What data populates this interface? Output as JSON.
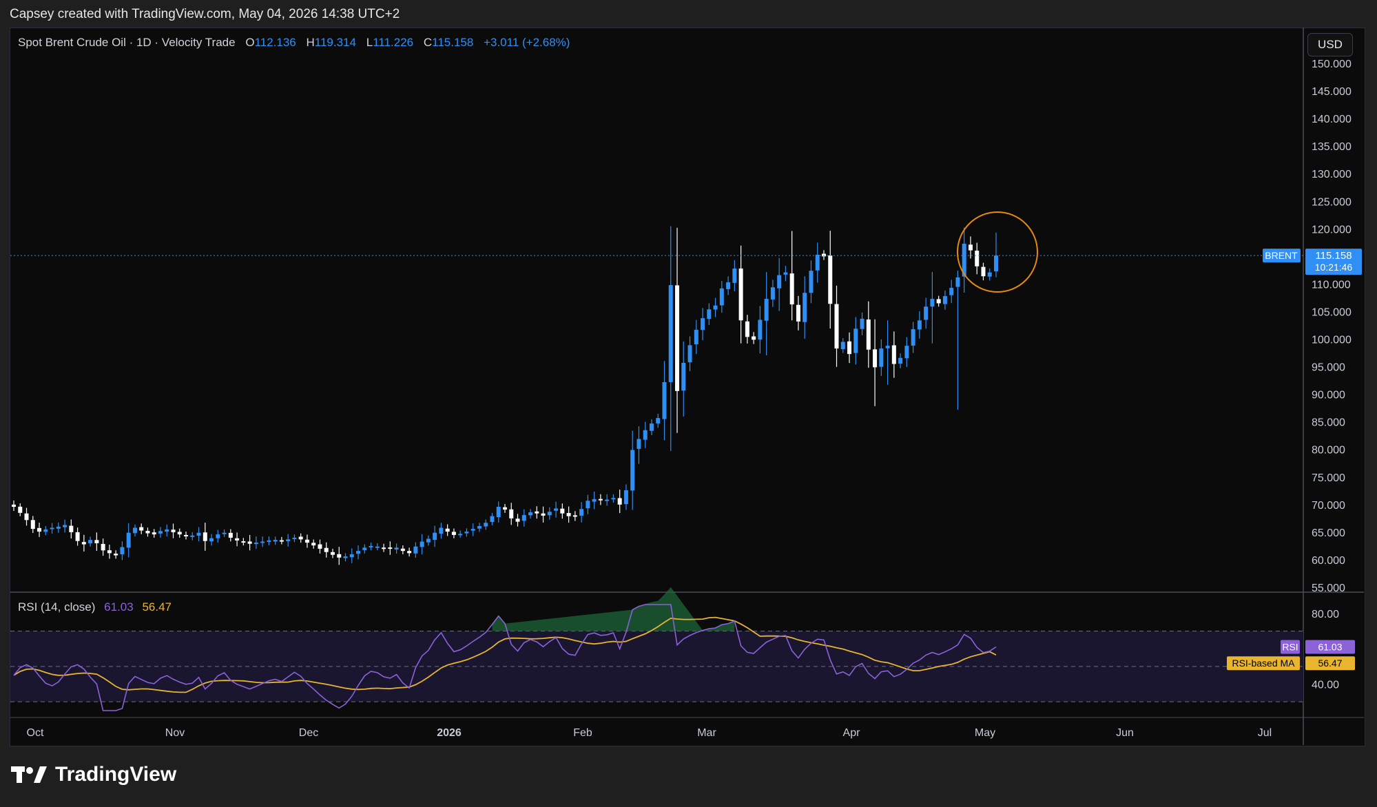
{
  "header": {
    "credit": "Capsey created with TradingView.com, May 04, 2026 14:38 UTC+2"
  },
  "legend": {
    "title": "Spot Brent Crude Oil · 1D · Velocity Trade",
    "o_label": "O",
    "o": "112.136",
    "h_label": "H",
    "h": "119.314",
    "l_label": "L",
    "l": "111.226",
    "c_label": "C",
    "c": "115.158",
    "change": "+3.011 (+2.68%)"
  },
  "currency_button": "USD",
  "price_tag": {
    "symbol": "BRENT",
    "price": "115.158",
    "countdown": "10:21:46"
  },
  "rsi_legend": {
    "label": "RSI (14, close)",
    "rsi": "61.03",
    "ma": "56.47"
  },
  "rsi_tags": {
    "rsi_label": "RSI",
    "rsi_value": "61.03",
    "ma_label": "RSI-based MA",
    "ma_value": "56.47"
  },
  "brand": {
    "name": "TradingView"
  },
  "colors": {
    "up": "#2f8ff5",
    "down": "#ffffff",
    "rsi": "#8b62d8",
    "rsi_ma": "#e9b52f",
    "highlight_circle": "#e8890c",
    "background": "#0b0b0b"
  },
  "chart_data": [
    {
      "type": "candlestick",
      "title": "Spot Brent Crude Oil · 1D · Velocity Trade",
      "x_axis_labels": [
        "Oct",
        "Nov",
        "Dec",
        "2026",
        "Feb",
        "Mar",
        "Apr",
        "May",
        "Jun",
        "Jul"
      ],
      "y_axis_ticks": [
        "55.000",
        "60.000",
        "65.000",
        "70.000",
        "75.000",
        "80.000",
        "85.000",
        "90.000",
        "95.000",
        "100.000",
        "105.000",
        "110.000",
        "115.000",
        "120.000",
        "125.000",
        "130.000",
        "135.000",
        "140.000",
        "145.000",
        "150.000"
      ],
      "ylim": [
        55,
        150
      ],
      "last_price": 115.158,
      "annotation": "circle highlighting latest candles near 115",
      "closes": [
        69.6,
        68.5,
        67.2,
        65.6,
        65.1,
        65.5,
        65.8,
        66.0,
        66.3,
        65.0,
        63.4,
        62.8,
        63.6,
        63.0,
        61.7,
        61.2,
        60.8,
        62.3,
        64.9,
        65.8,
        65.3,
        64.8,
        64.6,
        65.2,
        65.5,
        65.0,
        64.6,
        64.3,
        64.4,
        64.9,
        63.4,
        63.9,
        64.6,
        64.9,
        64.0,
        63.5,
        63.2,
        62.9,
        63.1,
        63.3,
        63.5,
        63.6,
        63.4,
        63.7,
        64.0,
        63.7,
        63.1,
        62.6,
        62.0,
        61.4,
        60.9,
        60.4,
        60.6,
        61.0,
        61.6,
        62.2,
        62.5,
        62.4,
        62.1,
        62.0,
        62.2,
        61.6,
        61.2,
        62.4,
        63.3,
        63.8,
        64.9,
        65.8,
        65.1,
        64.5,
        64.7,
        65.1,
        65.6,
        66.1,
        66.7,
        67.9,
        69.6,
        69.1,
        67.5,
        66.9,
        68.1,
        68.6,
        68.4,
        68.0,
        68.7,
        69.3,
        68.4,
        67.9,
        67.8,
        69.2,
        70.7,
        71.0,
        70.8,
        70.9,
        71.2,
        70.0,
        72.6,
        79.9,
        81.9,
        83.5,
        84.7,
        85.7,
        92.2,
        109.8,
        90.6,
        95.7,
        98.9,
        101.7,
        103.8,
        105.4,
        106.1,
        109.2,
        110.3,
        112.8,
        103.4,
        100.4,
        99.9,
        103.5,
        107.3,
        109.4,
        111.6,
        112.1,
        106.3,
        103.2,
        108.4,
        112.4,
        115.3,
        115.0,
        106.4,
        98.3,
        99.5,
        97.3,
        101.9,
        103.7,
        98.1,
        94.9,
        98.3,
        98.8,
        95.5,
        96.6,
        98.8,
        101.8,
        103.4,
        105.9,
        107.3,
        106.5,
        107.8,
        109.3,
        111.2,
        117.3,
        116.1,
        113.2,
        111.4,
        112.1,
        115.158
      ],
      "rsi": {
        "name": "RSI",
        "length": 14,
        "last": 61.03,
        "ma_name": "RSI-based MA",
        "ma_last": 56.47,
        "levels": [
          70,
          50,
          30
        ],
        "visible_ticks": [
          "80.00",
          "40.00"
        ]
      }
    }
  ]
}
